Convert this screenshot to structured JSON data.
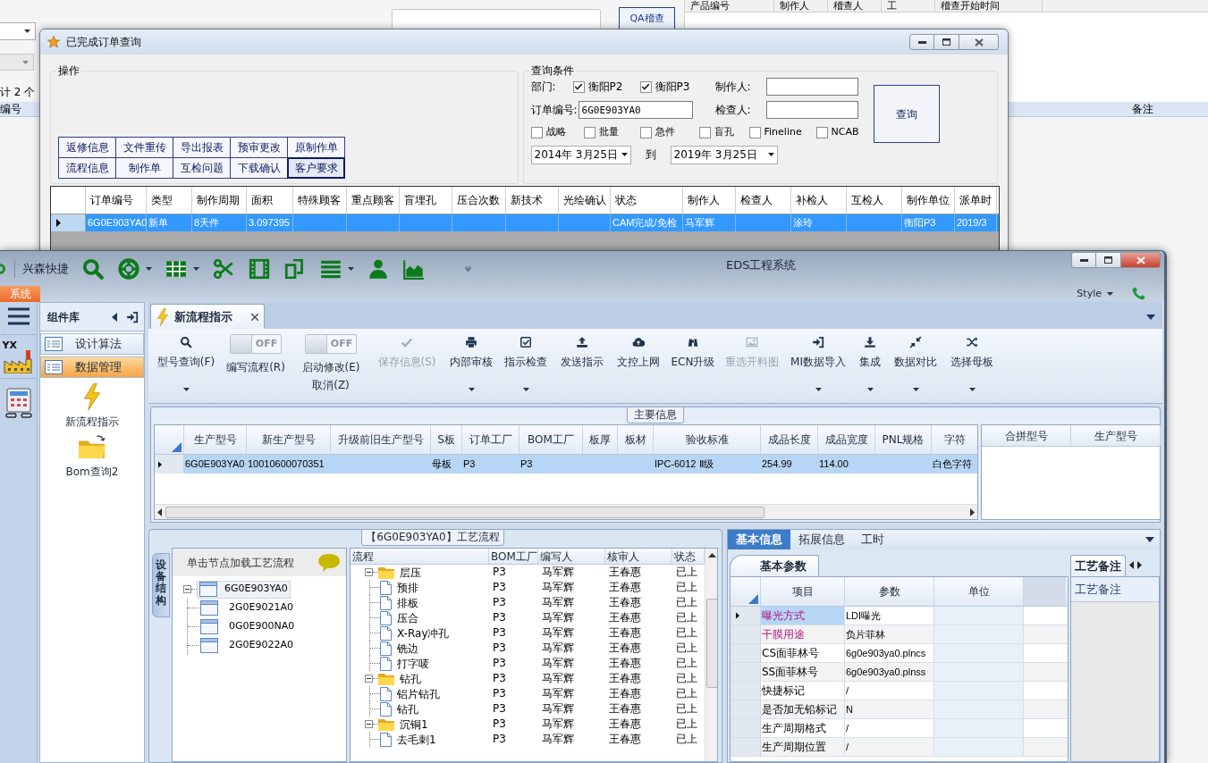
{
  "background_app": {
    "qa_button": "QA稽查",
    "record_count": "计 2 个",
    "table_columns": [
      "产品编号",
      "制作人",
      "稽查人",
      "工",
      "稽查开始时间"
    ],
    "list_columns": [
      "编号",
      "备注"
    ]
  },
  "dialog": {
    "title": "已完成订单查询",
    "operations": {
      "title": "操作",
      "buttons": [
        {
          "label": "返修信息",
          "focused": false
        },
        {
          "label": "文件重传",
          "focused": false
        },
        {
          "label": "导出报表",
          "focused": false
        },
        {
          "label": "预审更改",
          "focused": false
        },
        {
          "label": "原制作单",
          "focused": false
        },
        {
          "label": "流程信息",
          "focused": false
        },
        {
          "label": "制作单",
          "focused": false
        },
        {
          "label": "互检问题",
          "focused": false
        },
        {
          "label": "下载确认",
          "focused": false
        },
        {
          "label": "客户要求",
          "focused": true
        }
      ]
    },
    "query": {
      "title": "查询条件",
      "department_label": "部门:",
      "departments": [
        {
          "label": "衡阳P2",
          "checked": true
        },
        {
          "label": "衡阳P3",
          "checked": true
        }
      ],
      "maker_label": "制作人:",
      "order_label": "订单编号:",
      "order_value": "6G0E903YA0",
      "checker_label": "检查人:",
      "flags": [
        {
          "label": "战略",
          "checked": false
        },
        {
          "label": "批量",
          "checked": false
        },
        {
          "label": "急件",
          "checked": false
        },
        {
          "label": "盲孔",
          "checked": false
        },
        {
          "label": "Fineline",
          "checked": false
        },
        {
          "label": "NCAB",
          "checked": false
        }
      ],
      "date_from": "2014年 3月25日",
      "date_separator": "到",
      "date_to": "2019年 3月25日",
      "search_button": "查询"
    },
    "grid": {
      "columns": [
        "订单编号",
        "类型",
        "制作周期",
        "面积",
        "特殊顾客",
        "重点顾客",
        "盲埋孔",
        "压合次数",
        "新技术",
        "光绘确认",
        "状态",
        "制作人",
        "检查人",
        "补检人",
        "互检人",
        "制作单位",
        "派单时"
      ],
      "rows": [
        {
          "selected": true,
          "cells": [
            "6G0E903YA0",
            "新单",
            "8天件",
            "3.097395",
            null,
            null,
            null,
            null,
            null,
            null,
            "CAM完成/免检",
            "马军辉",
            null,
            "涂玲",
            null,
            "衡阳P3",
            "2019/3"
          ]
        }
      ]
    }
  },
  "main_window": {
    "title": "EDS工程系统",
    "quick_access_label": "兴森快捷",
    "ribbon_tab": "系统",
    "style_menu": "Style",
    "logo_text": "YX",
    "component_panel": {
      "title": "组件库",
      "categories": [
        {
          "label": "设计算法",
          "selected": false
        },
        {
          "label": "数据管理",
          "selected": true
        }
      ],
      "items": [
        {
          "label": "新流程指示",
          "kind": "lightning"
        },
        {
          "label": "Bom查询2",
          "kind": "folder"
        }
      ]
    },
    "document_tab": {
      "label": "新流程指示"
    },
    "toolbar": [
      {
        "kind": "button",
        "label": "型号查询(F)",
        "disabled": false,
        "dropdown": true
      },
      {
        "kind": "toggle",
        "label": "编写流程(R)",
        "state_text": "OFF",
        "on": false
      },
      {
        "kind": "toggle",
        "label": "启动修改(E)",
        "sublabel": "取消(Z)",
        "state_text": "OFF",
        "on": false
      },
      {
        "kind": "button",
        "label": "保存信息(S)",
        "disabled": true,
        "dropdown": false
      },
      {
        "kind": "button",
        "label": "内部审核",
        "disabled": false,
        "dropdown": true
      },
      {
        "kind": "button",
        "label": "指示检查",
        "disabled": false,
        "dropdown": true
      },
      {
        "kind": "button",
        "label": "发送指示",
        "disabled": false,
        "dropdown": false
      },
      {
        "kind": "button",
        "label": "文控上网",
        "disabled": false,
        "dropdown": false
      },
      {
        "kind": "button",
        "label": "ECN升级",
        "disabled": false,
        "dropdown": false
      },
      {
        "kind": "button",
        "label": "重选开料图",
        "disabled": true,
        "dropdown": false
      },
      {
        "kind": "button",
        "label": "MI数据导入",
        "disabled": false,
        "dropdown": true
      },
      {
        "kind": "button",
        "label": "集成",
        "disabled": false,
        "dropdown": true
      },
      {
        "kind": "button",
        "label": "数据对比",
        "disabled": false,
        "dropdown": true
      },
      {
        "kind": "button",
        "label": "选择母板",
        "disabled": false,
        "dropdown": true
      }
    ],
    "main_info": {
      "title": "主要信息",
      "columns": [
        "生产型号",
        "新生产型号",
        "升级前旧生产型号",
        "S板",
        "订单工厂",
        "BOM工厂",
        "板厚",
        "板材",
        "验收标准",
        "成品长度",
        "成品宽度",
        "PNL规格",
        "字符"
      ],
      "rows": [
        {
          "selected": true,
          "cells": [
            "6G0E903YA0",
            "10010600070351",
            null,
            "母板",
            "P3",
            "P3",
            null,
            null,
            "IPC-6012 Ⅱ级",
            "254.99",
            "114.00",
            null,
            "白色字符"
          ]
        }
      ],
      "merge_columns": [
        "合拼型号",
        "生产型号"
      ]
    },
    "process": {
      "title": "【6G0E903YA0】工艺流程",
      "side_tab": "设备结构",
      "tree_hint": "单击节点加载工艺流程",
      "tree": [
        {
          "label": "6G0E903YA0",
          "expanded": true,
          "selected": true,
          "children": [
            {
              "label": "2G0E9021A0",
              "selected": false
            },
            {
              "label": "0G0E900NA0",
              "selected": false
            },
            {
              "label": "2G0E9022A0",
              "selected": false
            }
          ]
        }
      ],
      "columns": [
        "流程",
        "BOM工厂",
        "编写人",
        "核审人",
        "状态"
      ],
      "rows": [
        {
          "label": "层压",
          "factory": "P3",
          "writer": "马军辉",
          "reviewer": "王春惠",
          "status": "已上",
          "expanded": true,
          "children": [
            {
              "label": "预排",
              "factory": "P3",
              "writer": "马军辉",
              "reviewer": "王春惠",
              "status": "已上"
            },
            {
              "label": "排板",
              "factory": "P3",
              "writer": "马军辉",
              "reviewer": "王春惠",
              "status": "已上"
            },
            {
              "label": "压合",
              "factory": "P3",
              "writer": "马军辉",
              "reviewer": "王春惠",
              "status": "已上"
            },
            {
              "label": "X-Ray冲孔",
              "factory": "P3",
              "writer": "马军辉",
              "reviewer": "王春惠",
              "status": "已上"
            },
            {
              "label": "铣边",
              "factory": "P3",
              "writer": "马军辉",
              "reviewer": "王春惠",
              "status": "已上"
            },
            {
              "label": "打字唛",
              "factory": "P3",
              "writer": "马军辉",
              "reviewer": "王春惠",
              "status": "已上"
            }
          ]
        },
        {
          "label": "钻孔",
          "factory": "P3",
          "writer": "马军辉",
          "reviewer": "王春惠",
          "status": "已上",
          "expanded": true,
          "children": [
            {
              "label": "铝片钻孔",
              "factory": "P3",
              "writer": "马军辉",
              "reviewer": "王春惠",
              "status": "已上"
            },
            {
              "label": "钻孔",
              "factory": "P3",
              "writer": "马军辉",
              "reviewer": "王春惠",
              "status": "已上"
            }
          ]
        },
        {
          "label": "沉铜1",
          "factory": "P3",
          "writer": "马军辉",
          "reviewer": "王春惠",
          "status": "已上",
          "expanded": true,
          "children": [
            {
              "label": "去毛刺1",
              "factory": "P3",
              "writer": "马军辉",
              "reviewer": "王春惠",
              "status": "已上"
            }
          ]
        }
      ]
    },
    "details": {
      "tabs": [
        {
          "label": "基本信息",
          "selected": true
        },
        {
          "label": "拓展信息",
          "selected": false
        },
        {
          "label": "工时",
          "selected": false
        }
      ],
      "subtab": "基本参数",
      "columns": [
        "项目",
        "参数",
        "单位"
      ],
      "rows": [
        {
          "item": "曝光方式",
          "value": "LDI曝光",
          "required": true,
          "selected": true
        },
        {
          "item": "干膜用途",
          "value": "负片菲林",
          "required": true,
          "selected": false
        },
        {
          "item": "CS面菲林号",
          "value": "6g0e903ya0.plncs",
          "required": false,
          "selected": false
        },
        {
          "item": "SS面菲林号",
          "value": "6g0e903ya0.plnss",
          "required": false,
          "selected": false
        },
        {
          "item": "快捷标记",
          "value": "/",
          "required": false,
          "selected": false
        },
        {
          "item": "是否加无铅标记",
          "value": "N",
          "required": false,
          "selected": false
        },
        {
          "item": "生产周期格式",
          "value": "/",
          "required": false,
          "selected": false
        },
        {
          "item": "生产周期位置",
          "value": "/",
          "required": false,
          "selected": false
        }
      ],
      "notes_tab": "工艺备注",
      "notes_column": "工艺备注"
    }
  }
}
